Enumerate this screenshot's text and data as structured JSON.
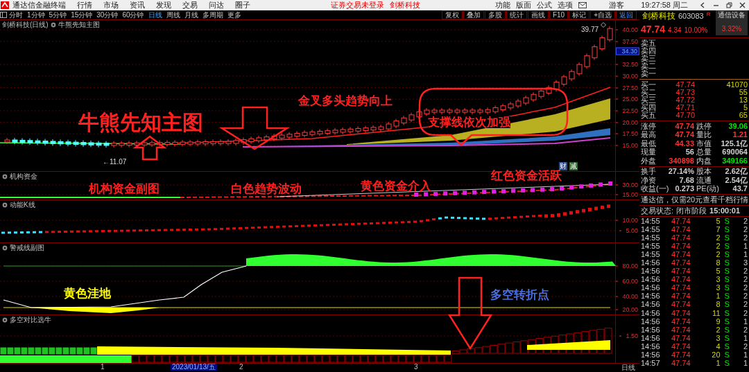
{
  "menu_bar": {
    "app_title": "通达信金融终端",
    "menus": [
      "行情",
      "市场",
      "资讯",
      "发现",
      "交易",
      "问达",
      "圈子"
    ],
    "notices": [
      "证券交易未登录",
      "剑桥科技"
    ],
    "tools": [
      "功能",
      "版面",
      "公式",
      "选项"
    ],
    "user": "游客",
    "clock": "19:27:58 周二"
  },
  "toolbar": {
    "periods": [
      {
        "label": "分时",
        "selected": false
      },
      {
        "label": "1分钟",
        "selected": false
      },
      {
        "label": "5分钟",
        "selected": false
      },
      {
        "label": "15分钟",
        "selected": false
      },
      {
        "label": "30分钟",
        "selected": false
      },
      {
        "label": "60分钟",
        "selected": false
      },
      {
        "label": "日线",
        "selected": true
      },
      {
        "label": "周线",
        "selected": false
      },
      {
        "label": "月线",
        "selected": false
      },
      {
        "label": "多周期",
        "selected": false
      },
      {
        "label": "更多",
        "selected": false
      }
    ],
    "buttons": [
      {
        "label": "复权",
        "selected": false
      },
      {
        "label": "叠加",
        "selected": false
      },
      {
        "label": "多股",
        "selected": false
      },
      {
        "label": "统计",
        "selected": false
      },
      {
        "label": "画线",
        "selected": false
      },
      {
        "label": "F10",
        "selected": false
      },
      {
        "label": "标记",
        "selected": false
      },
      {
        "label": "+自选",
        "selected": false
      },
      {
        "label": "返回",
        "selected": true
      }
    ]
  },
  "main_chart": {
    "title": "剑桥科技(日线)",
    "indicator": "牛熊先知主图",
    "high_label": "39.77",
    "low_label": "←11.07",
    "price_tag": "34.30",
    "y_ticks": [
      "40.00",
      "37.50",
      "32.50",
      "30.00",
      "27.50",
      "25.00",
      "22.50",
      "20.00",
      "17.50",
      "15.00"
    ],
    "badges": [
      "财",
      "减"
    ],
    "annotations": [
      {
        "text": "牛熊先知主图",
        "color": "#ff2020"
      },
      {
        "text": "金叉多头趋势向上",
        "color": "#ff2020"
      },
      {
        "text": "支撑线依次加强",
        "color": "#ff2020"
      }
    ]
  },
  "sub_charts": [
    {
      "title": "机构资金",
      "y_ticks": [
        "30.00",
        "15.00"
      ],
      "annotations": [
        {
          "text": "机构资金副图",
          "color": "#ff2020"
        },
        {
          "text": "白色趋势波动",
          "color": "#ff2020"
        },
        {
          "text": "黄色资金介入",
          "color": "#ff2020"
        },
        {
          "text": "红色资金活跃",
          "color": "#ff2020"
        }
      ]
    },
    {
      "title": "动能K线",
      "y_ticks": [
        "10.00",
        "5.00"
      ]
    },
    {
      "title": "警戒线副图",
      "y_ticks": [
        "80.00",
        "60.00",
        "40.00",
        "20.00"
      ],
      "annotations": [
        {
          "text": "黄色洼地",
          "color": "#ffff00"
        },
        {
          "text": "多空转折点",
          "color": "#4a6ee0"
        }
      ]
    },
    {
      "title": "多空对比选牛",
      "y_ticks": [
        "1.50"
      ]
    }
  ],
  "x_axis": {
    "labels": [
      {
        "text": "1",
        "selected": false
      },
      {
        "text": "2023/01/13/五",
        "selected": true
      },
      {
        "text": "2",
        "selected": false
      },
      {
        "text": "3",
        "selected": false
      }
    ],
    "period": "日线"
  },
  "quote": {
    "name": "剑桥科技",
    "code": "603083",
    "flag": "R",
    "sector": "通信设备",
    "sector_change": "3.32%",
    "price": "47.74",
    "change": "4.34",
    "change_pct": "10.00%",
    "asks": [
      "卖五",
      "卖四",
      "卖三",
      "卖二",
      "卖一"
    ],
    "bids": [
      {
        "label": "买一",
        "price": "47.74",
        "volume": "41070"
      },
      {
        "label": "买二",
        "price": "47.73",
        "volume": "55"
      },
      {
        "label": "买三",
        "price": "47.72",
        "volume": "13"
      },
      {
        "label": "买四",
        "price": "47.71",
        "volume": "5"
      },
      {
        "label": "买五",
        "price": "47.70",
        "volume": "65"
      }
    ],
    "stats": [
      {
        "label": "涨停",
        "value": "47.74",
        "color": "#ff3232"
      },
      {
        "label": "跌停",
        "value": "39.06",
        "color": "#00e600"
      },
      {
        "label": "最高",
        "value": "47.74",
        "color": "#ff3232"
      },
      {
        "label": "量比",
        "value": "1.21",
        "color": "#ff3232"
      },
      {
        "label": "最低",
        "value": "44.33",
        "color": "#ff3232"
      },
      {
        "label": "市值",
        "value": "125.1亿",
        "color": "#d0d0d0"
      },
      {
        "label": "现量",
        "value": "56",
        "color": "#d0d0d0"
      },
      {
        "label": "总量",
        "value": "690064",
        "color": "#d0d0d0"
      },
      {
        "label": "外盘",
        "value": "340898",
        "color": "#ff3232"
      },
      {
        "label": "内盘",
        "value": "349166",
        "color": "#00e600"
      },
      {
        "label": "换手",
        "value": "27.14%",
        "color": "#d0d0d0"
      },
      {
        "label": "股本",
        "value": "2.62亿",
        "color": "#d0d0d0"
      },
      {
        "label": "净资",
        "value": "7.68",
        "color": "#d0d0d0"
      },
      {
        "label": "流通",
        "value": "2.54亿",
        "color": "#d0d0d0"
      },
      {
        "label": "收益(一)",
        "value": "0.273",
        "color": "#d0d0d0"
      },
      {
        "label": "PE(动)",
        "value": "43.7",
        "color": "#d0d0d0"
      }
    ],
    "promo": "通达信，仅需20元查看千档行情",
    "status_label": "交易状态:",
    "status": "闭市阶段",
    "status_time": "15:00:01",
    "ticks": [
      {
        "time": "14:55",
        "price": "47.74",
        "volume": "5",
        "side": "S",
        "count": "2"
      },
      {
        "time": "14:55",
        "price": "47.74",
        "volume": "7",
        "side": "S",
        "count": "2"
      },
      {
        "time": "14:55",
        "price": "47.74",
        "volume": "2",
        "side": "S",
        "count": "2"
      },
      {
        "time": "14:55",
        "price": "47.74",
        "volume": "2",
        "side": "S",
        "count": "1"
      },
      {
        "time": "14:55",
        "price": "47.74",
        "volume": "2",
        "side": "S",
        "count": "1"
      },
      {
        "time": "14:56",
        "price": "47.74",
        "volume": "8",
        "side": "S",
        "count": "3"
      },
      {
        "time": "14:56",
        "price": "47.74",
        "volume": "5",
        "side": "S",
        "count": "2"
      },
      {
        "time": "14:56",
        "price": "47.74",
        "volume": "3",
        "side": "S",
        "count": "2"
      },
      {
        "time": "14:56",
        "price": "47.74",
        "volume": "3",
        "side": "S",
        "count": "2"
      },
      {
        "time": "14:56",
        "price": "47.74",
        "volume": "1",
        "side": "S",
        "count": "2"
      },
      {
        "time": "14:56",
        "price": "47.74",
        "volume": "8",
        "side": "S",
        "count": "2"
      },
      {
        "time": "14:56",
        "price": "47.74",
        "volume": "11",
        "side": "S",
        "count": "2"
      },
      {
        "time": "14:56",
        "price": "47.74",
        "volume": "9",
        "side": "S",
        "count": "1"
      },
      {
        "time": "14:56",
        "price": "47.74",
        "volume": "2",
        "side": "S",
        "count": "2"
      },
      {
        "time": "14:56",
        "price": "47.74",
        "volume": "3",
        "side": "S",
        "count": "1"
      },
      {
        "time": "14:56",
        "price": "47.74",
        "volume": "4",
        "side": "S",
        "count": "2"
      },
      {
        "time": "14:56",
        "price": "47.74",
        "volume": "20",
        "side": "S",
        "count": "1"
      },
      {
        "time": "14:57",
        "price": "47.74",
        "volume": "1",
        "side": "S",
        "count": "1"
      }
    ]
  }
}
